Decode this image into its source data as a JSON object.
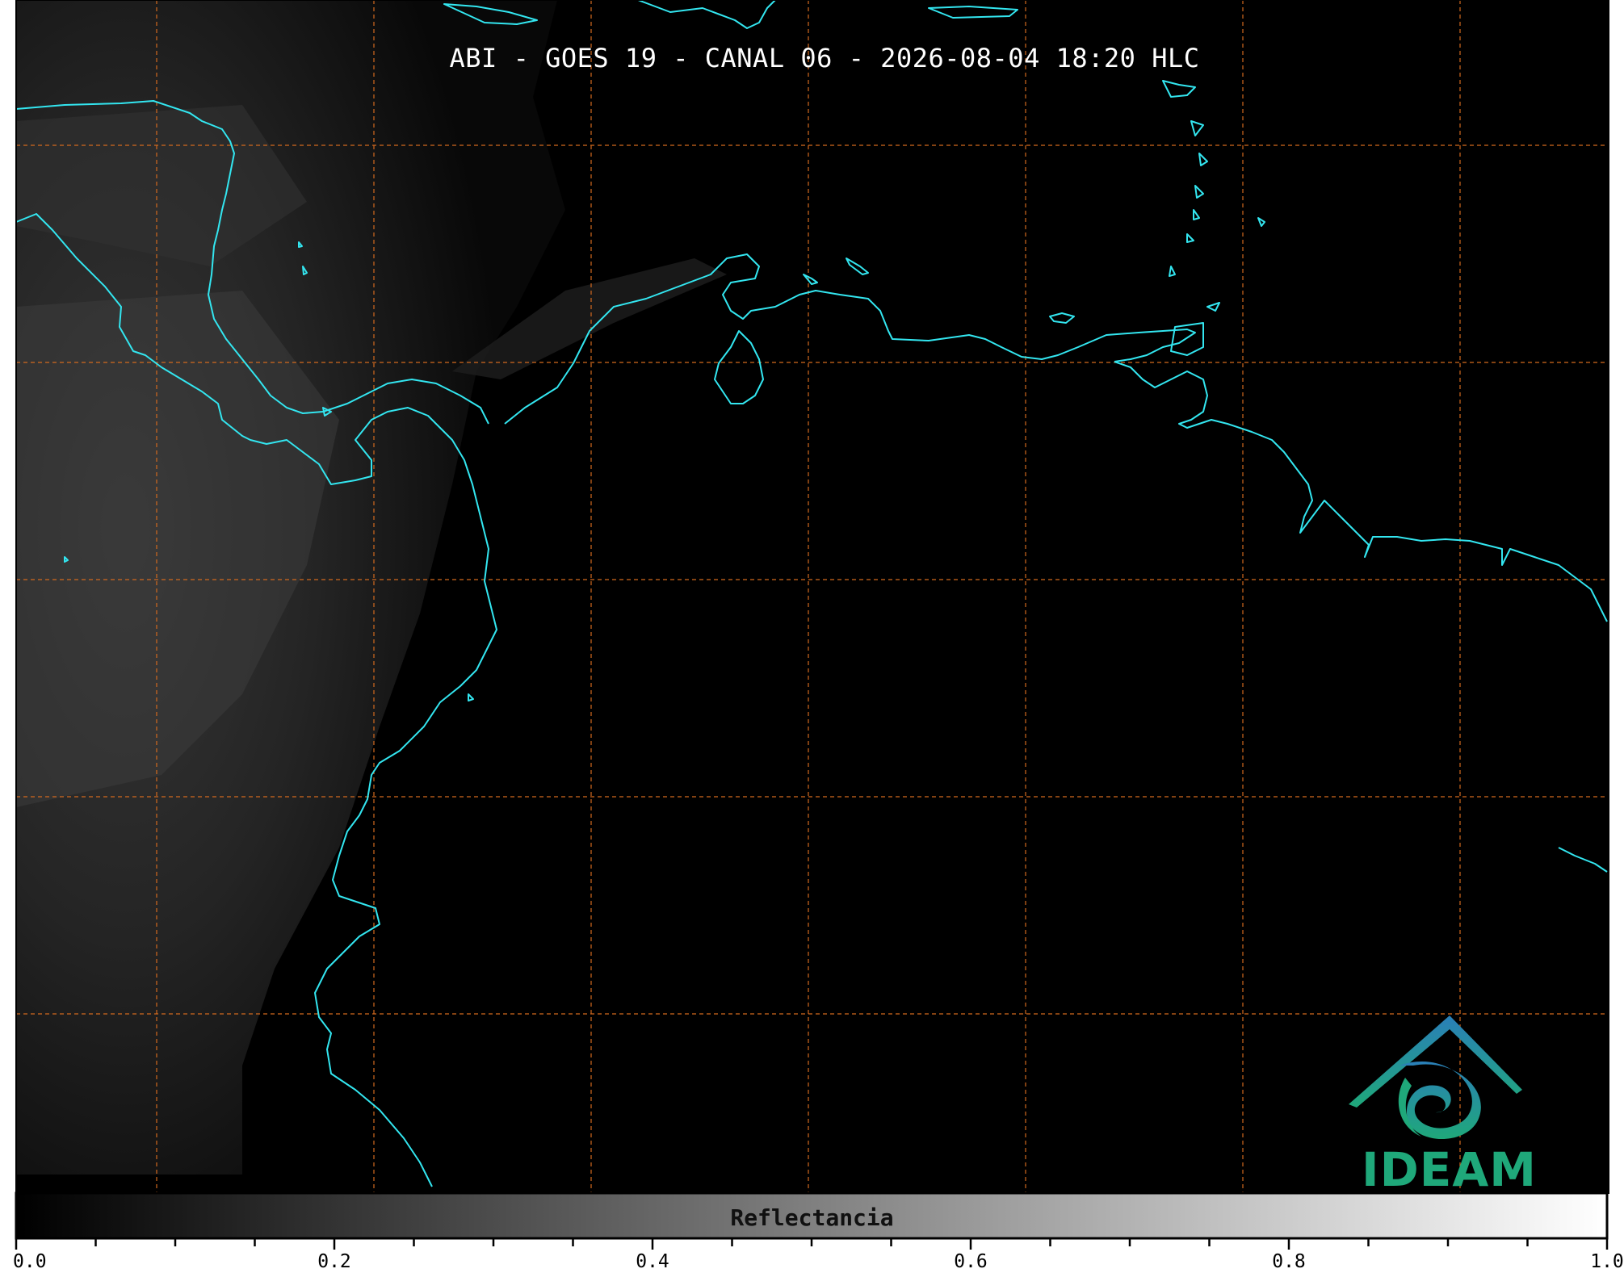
{
  "title": "ABI - GOES 19 - CANAL 06 - 2026-08-04 18:20 HLC",
  "colors": {
    "background": "#000000",
    "coastline": "#33e6f0",
    "gridline": "#d2691e",
    "colorbar_start": "#000000",
    "colorbar_end": "#ffffff",
    "logo_teal": "#1fa87a",
    "logo_blue": "#2a7fb8"
  },
  "colorbar": {
    "label": "Reflectancia",
    "ticks": [
      "0.0",
      "0.2",
      "0.4",
      "0.6",
      "0.8",
      "1.0"
    ],
    "range": [
      0.0,
      1.0
    ]
  },
  "logo": {
    "text": "IDEAM",
    "icon": "ideam-mountain-spiral-icon"
  },
  "map": {
    "gridlines": "dashed lat/lon grid",
    "coastlines": true
  }
}
